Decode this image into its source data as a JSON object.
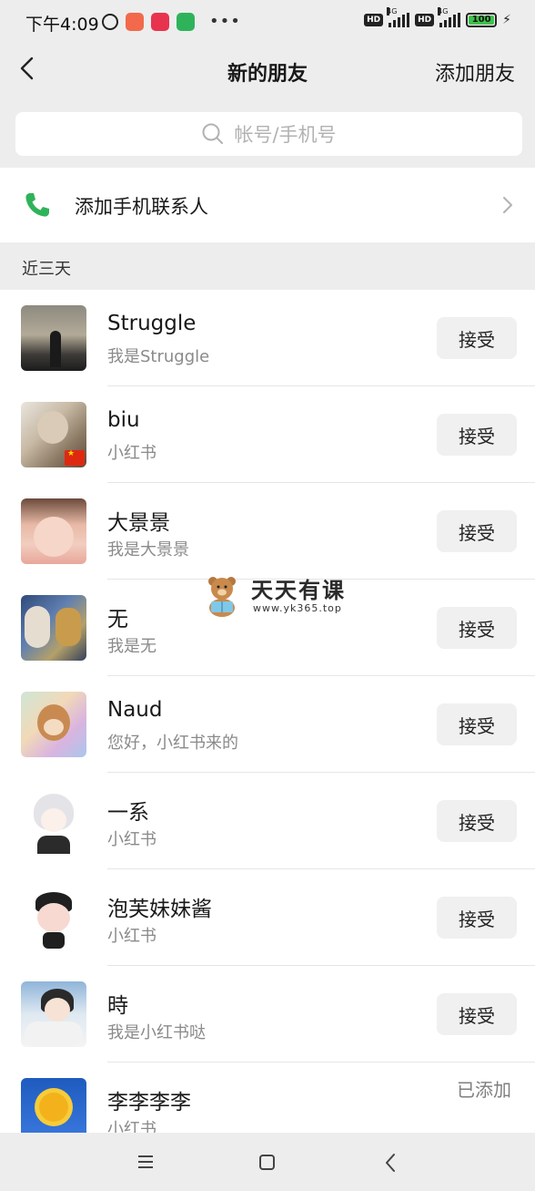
{
  "status_bar": {
    "time": "下午4:09",
    "network_1": "4G",
    "network_2": "4G",
    "hd": "HD",
    "battery": "100"
  },
  "nav": {
    "title": "新的朋友",
    "add_friend": "添加朋友"
  },
  "search": {
    "placeholder": "帐号/手机号"
  },
  "add_phone_contacts": {
    "label": "添加手机联系人"
  },
  "section": {
    "title": "近三天"
  },
  "requests": [
    {
      "name": "Struggle",
      "message": "我是Struggle",
      "action": "接受"
    },
    {
      "name": "biu",
      "message": "小红书",
      "action": "接受"
    },
    {
      "name": "大景景",
      "message": "我是大景景",
      "action": "接受"
    },
    {
      "name": "无",
      "message": "我是无",
      "action": "接受"
    },
    {
      "name": "Naud",
      "message": "您好，小红书来的",
      "action": "接受"
    },
    {
      "name": "一系",
      "message": "小红书",
      "action": "接受"
    },
    {
      "name": "泡芙妹妹酱",
      "message": "小红书",
      "action": "接受"
    },
    {
      "name": "時",
      "message": "我是小红书哒",
      "action": "接受"
    },
    {
      "name": "李李李李",
      "message": "小红书",
      "status": "已添加"
    }
  ],
  "watermark": {
    "title": "天天有课",
    "url": "www.yk365.top"
  },
  "colors": {
    "background": "#ededed",
    "phone_icon": "#2fb35a",
    "accept_button": "#f0f0f0"
  }
}
